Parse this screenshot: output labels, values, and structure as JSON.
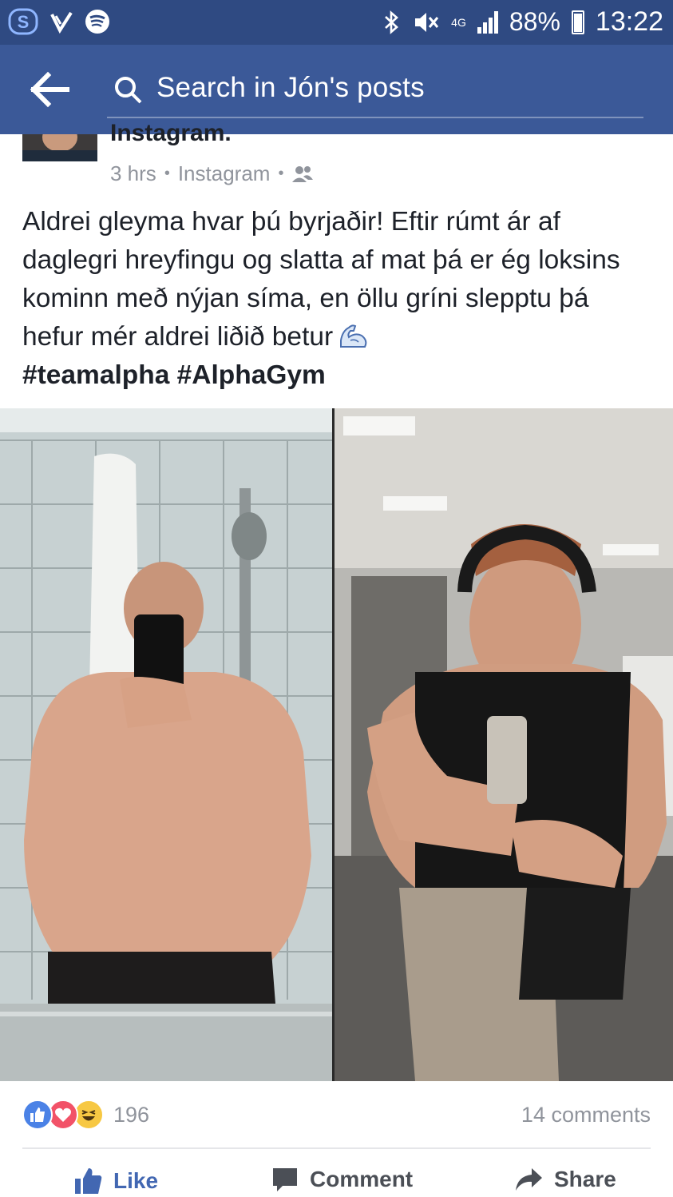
{
  "status_bar": {
    "network": "4G",
    "battery": "88%",
    "time": "13:22"
  },
  "nav": {
    "search_placeholder": "Search in Jón's posts"
  },
  "post": {
    "source_line": "Instagram.",
    "time_ago": "3 hrs",
    "via": "Instagram",
    "text": "Aldrei gleyma hvar þú byrjaðir! Eftir rúmt ár af daglegri hreyfingu og slatta af mat þá er ég loksins kominn með nýjan síma, en öllu gríni slepptu þá hefur mér aldrei liðið betur",
    "hashtags": "#teamalpha #AlphaGym"
  },
  "engagement": {
    "reaction_count": "196",
    "comments": "14 comments"
  },
  "actions": {
    "like": "Like",
    "comment": "Comment",
    "share": "Share"
  },
  "colors": {
    "status_bar": "#2f4a82",
    "nav": "#3b5998",
    "link": "#4267b2",
    "meta": "#90949c"
  }
}
